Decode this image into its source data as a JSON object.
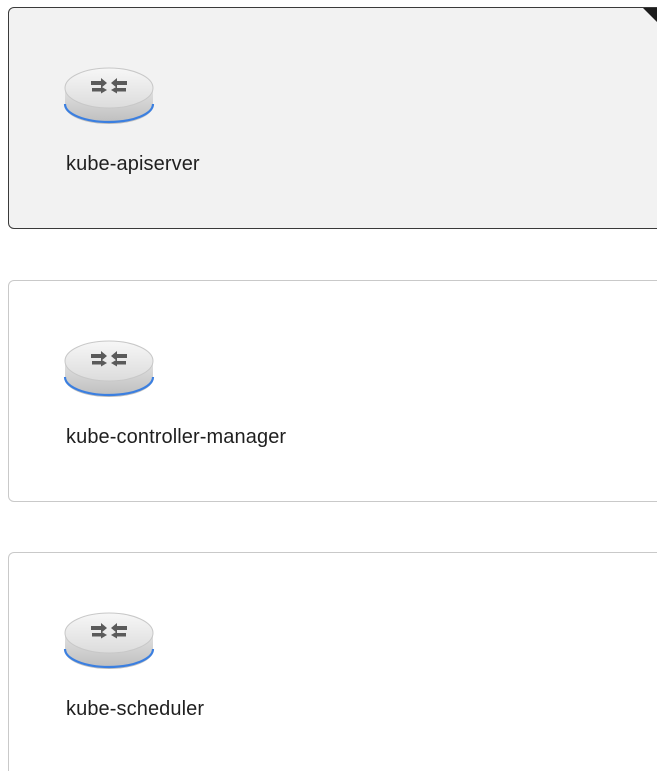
{
  "components": [
    {
      "label": "kube-apiserver",
      "icon": "router-icon",
      "selected": true
    },
    {
      "label": "kube-controller-manager",
      "icon": "router-icon",
      "selected": false
    },
    {
      "label": "kube-scheduler",
      "icon": "router-icon",
      "selected": false
    }
  ],
  "colors": {
    "selected_bg": "#f2f2f2",
    "selected_border": "#3a3a3a",
    "card_border": "#c9c9c9",
    "accent_ring": "#3b7fe0",
    "check_corner": "#1c1c1c"
  }
}
